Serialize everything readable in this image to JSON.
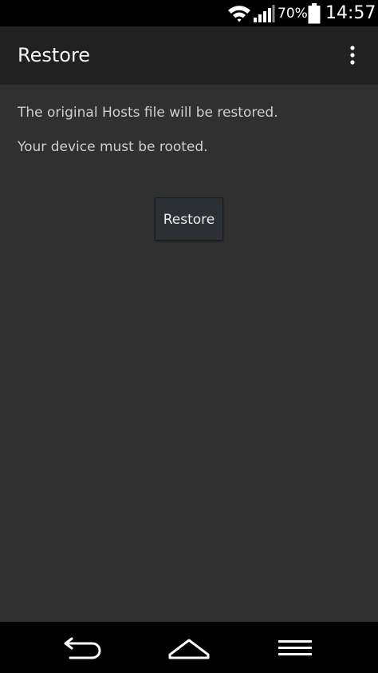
{
  "status_bar": {
    "battery_percent": "70%",
    "time": "14:57",
    "icons": [
      "wifi-icon",
      "signal-icon",
      "battery-icon"
    ]
  },
  "app_bar": {
    "title": "Restore",
    "menu_icon": "overflow-menu-icon"
  },
  "content": {
    "line1": "The original Hosts file will be restored.",
    "line2": "Your device must be rooted.",
    "restore_button": "Restore"
  },
  "nav_bar": {
    "icons": [
      "back-icon",
      "home-icon",
      "menu-icon"
    ]
  },
  "colors": {
    "background": "#303030",
    "app_bar": "#212121",
    "status_bar": "#000000",
    "text": "#cfcfcf",
    "button": "#2c3034"
  }
}
